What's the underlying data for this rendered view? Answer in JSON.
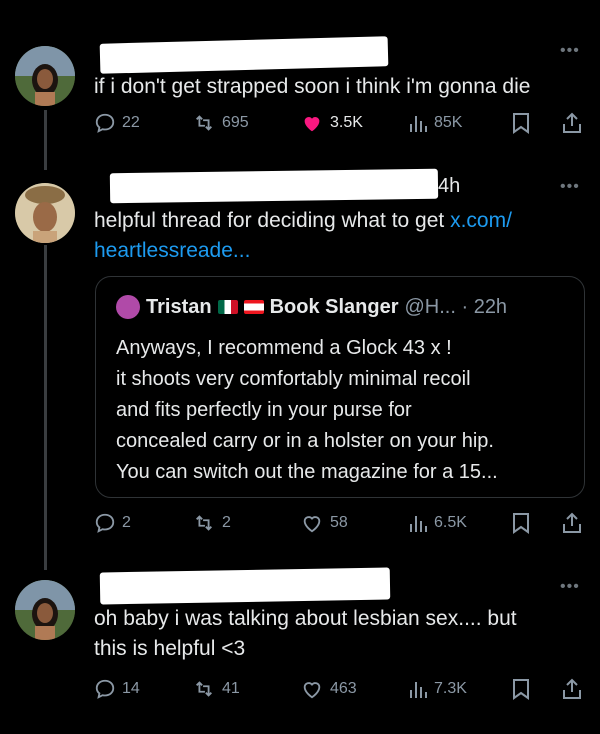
{
  "colors": {
    "background": "#000000",
    "text": "#e7e9ea",
    "muted": "#8b98a5",
    "link": "#1d9bf0",
    "like_active": "#f91880",
    "redaction": "#ffffff"
  },
  "tweets": [
    {
      "text_lines": [
        "if i don't get strapped soon i think i'm gonna die"
      ],
      "timestamp": "",
      "actions": {
        "replies": "22",
        "reposts": "695",
        "likes": "3.5K",
        "liked": true,
        "views": "85K"
      }
    },
    {
      "text_lines": [
        "helpful thread for deciding what to get "
      ],
      "link_inline": "x.com/",
      "link_second_line": "heartlessreade...",
      "timestamp": "4h",
      "quote": {
        "name_first": "Tristan",
        "name_second": "Book Slanger",
        "handle_time": "@H... · 22h",
        "body_lines": [
          "Anyways, I recommend a Glock 43 x !",
          "it shoots very comfortably  minimal recoil",
          "and fits perfectly in your purse for",
          "concealed carry or in a holster on your hip.",
          "You can switch out the magazine for a 15..."
        ]
      },
      "actions": {
        "replies": "2",
        "reposts": "2",
        "likes": "58",
        "liked": false,
        "views": "6.5K"
      }
    },
    {
      "text_lines": [
        "oh baby i was talking about lesbian sex.... but",
        "this is helpful <3"
      ],
      "timestamp": "",
      "actions": {
        "replies": "14",
        "reposts": "41",
        "likes": "463",
        "liked": false,
        "views": "7.3K"
      }
    }
  ],
  "icons": [
    "more-icon",
    "reply-icon",
    "repost-icon",
    "like-icon",
    "views-icon",
    "bookmark-icon",
    "share-icon",
    "flag-icon"
  ]
}
